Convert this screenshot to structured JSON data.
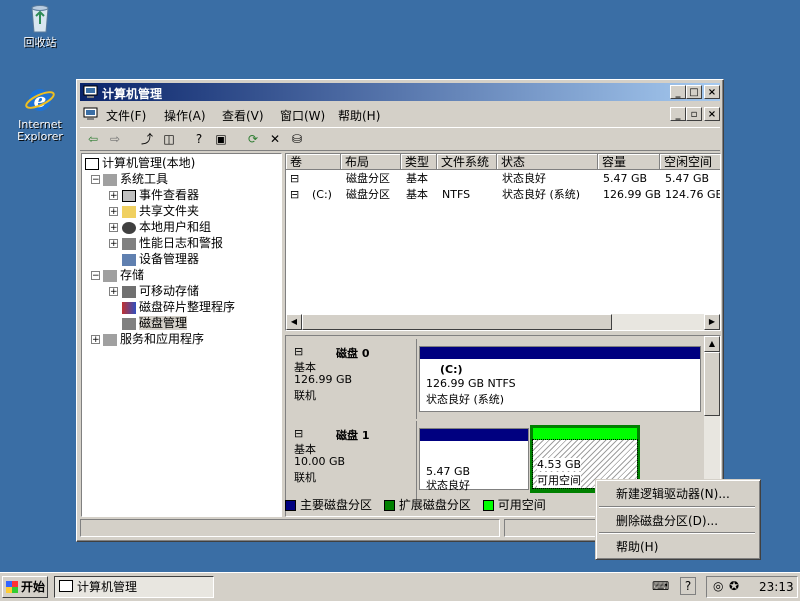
{
  "desktop": {
    "recycle_bin": "回收站",
    "ie_line1": "Internet",
    "ie_line2": "Explorer"
  },
  "window": {
    "title": "计算机管理",
    "menu": [
      "文件(F)",
      "操作(A)",
      "查看(V)",
      "窗口(W)",
      "帮助(H)"
    ]
  },
  "tree": {
    "root": "计算机管理(本地)",
    "system_tools": "系统工具",
    "event_viewer": "事件查看器",
    "shared_folders": "共享文件夹",
    "local_users": "本地用户和组",
    "perf_logs": "性能日志和警报",
    "device_manager": "设备管理器",
    "storage": "存储",
    "removable": "可移动存储",
    "defrag": "磁盘碎片整理程序",
    "disk_mgmt": "磁盘管理",
    "services_apps": "服务和应用程序"
  },
  "volume_list": {
    "columns": [
      "卷",
      "布局",
      "类型",
      "文件系统",
      "状态",
      "容量",
      "空闲空间"
    ],
    "rows": [
      {
        "volume": "",
        "layout": "磁盘分区",
        "type": "基本",
        "fs": "",
        "status": "状态良好",
        "capacity": "5.47 GB",
        "free": "5.47 GB"
      },
      {
        "volume": "(C:)",
        "layout": "磁盘分区",
        "type": "基本",
        "fs": "NTFS",
        "status": "状态良好 (系统)",
        "capacity": "126.99 GB",
        "free": "124.76 GB"
      }
    ]
  },
  "disks": {
    "disk0": {
      "name": "磁盘 0",
      "type": "基本",
      "size": "126.99 GB",
      "state": "联机",
      "vol_name": "(C:)",
      "vol_size": "126.99 GB NTFS",
      "vol_status": "状态良好 (系统)"
    },
    "disk1": {
      "name": "磁盘 1",
      "type": "基本",
      "size": "10.00 GB",
      "state": "联机",
      "part1_size": "5.47 GB",
      "part1_status": "状态良好",
      "part2_size": "4.53 GB",
      "part2_status": "可用空间"
    }
  },
  "legend": {
    "primary": "主要磁盘分区",
    "extended": "扩展磁盘分区",
    "free": "可用空间"
  },
  "context_menu": {
    "new_logical": "新建逻辑驱动器(N)...",
    "delete_partition": "删除磁盘分区(D)...",
    "help": "帮助(H)"
  },
  "taskbar": {
    "start": "开始",
    "task": "计算机管理",
    "clock": "23:13"
  },
  "colors": {
    "primary": "#000080",
    "extended": "#008000",
    "free": "#00ff00"
  }
}
